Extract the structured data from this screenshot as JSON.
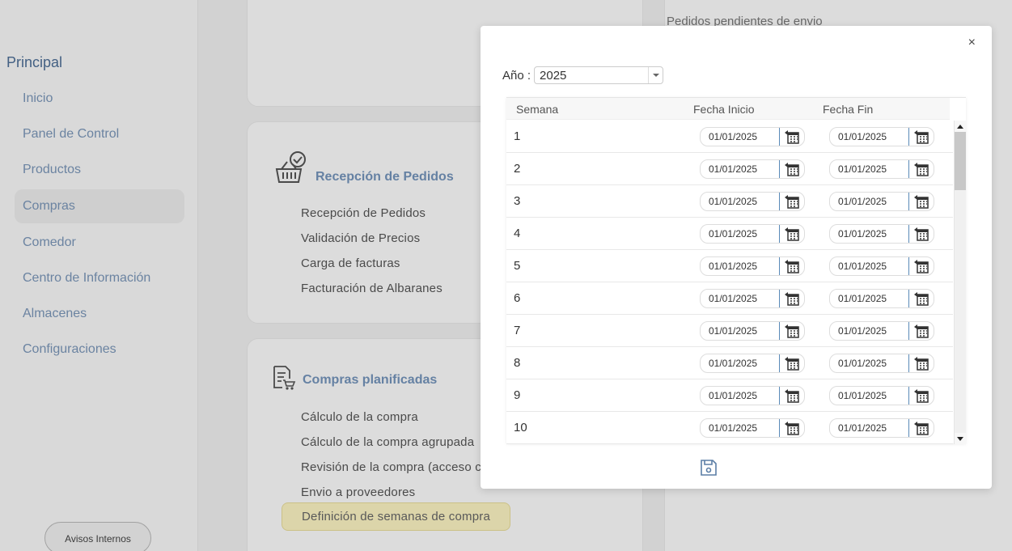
{
  "sidebar": {
    "section_title": "Principal",
    "items": [
      {
        "label": "Inicio"
      },
      {
        "label": "Panel de Control"
      },
      {
        "label": "Productos"
      },
      {
        "label": "Compras",
        "active": true
      },
      {
        "label": "Comedor"
      },
      {
        "label": "Centro de Información"
      },
      {
        "label": "Almacenes"
      },
      {
        "label": "Configuraciones"
      }
    ],
    "avisos_label": "Avisos Internos"
  },
  "right_panel": {
    "text": "Pedidos pendientes de envio"
  },
  "cards": {
    "recepcion": {
      "title": "Recepción de Pedidos",
      "links": [
        "Recepción de Pedidos",
        "Validación de Precios",
        "Carga de facturas",
        "Facturación de Albaranes"
      ]
    },
    "planificadas": {
      "title": "Compras planificadas",
      "links": [
        "Cálculo de la compra",
        "Cálculo de la compra agrupada",
        "Revisión de la compra (acceso co",
        "Envio a proveedores"
      ],
      "highlight_link": "Definición de semanas de compra"
    }
  },
  "modal": {
    "close_label": "×",
    "year_label": "Año :",
    "year_value": "2025",
    "columns": {
      "week": "Semana",
      "start": "Fecha Inicio",
      "end": "Fecha Fin"
    },
    "rows": [
      {
        "week": "1",
        "start": "01/01/2025",
        "end": "01/01/2025"
      },
      {
        "week": "2",
        "start": "01/01/2025",
        "end": "01/01/2025"
      },
      {
        "week": "3",
        "start": "01/01/2025",
        "end": "01/01/2025"
      },
      {
        "week": "4",
        "start": "01/01/2025",
        "end": "01/01/2025"
      },
      {
        "week": "5",
        "start": "01/01/2025",
        "end": "01/01/2025"
      },
      {
        "week": "6",
        "start": "01/01/2025",
        "end": "01/01/2025"
      },
      {
        "week": "7",
        "start": "01/01/2025",
        "end": "01/01/2025"
      },
      {
        "week": "8",
        "start": "01/01/2025",
        "end": "01/01/2025"
      },
      {
        "week": "9",
        "start": "01/01/2025",
        "end": "01/01/2025"
      },
      {
        "week": "10",
        "start": "01/01/2025",
        "end": "01/01/2025"
      }
    ],
    "icons": {
      "calendar": "calendar-icon",
      "save": "save-icon"
    }
  },
  "colors": {
    "accent": "#7393ba",
    "highlight": "#fbf3c2",
    "save_icon": "#5b7ea6"
  }
}
